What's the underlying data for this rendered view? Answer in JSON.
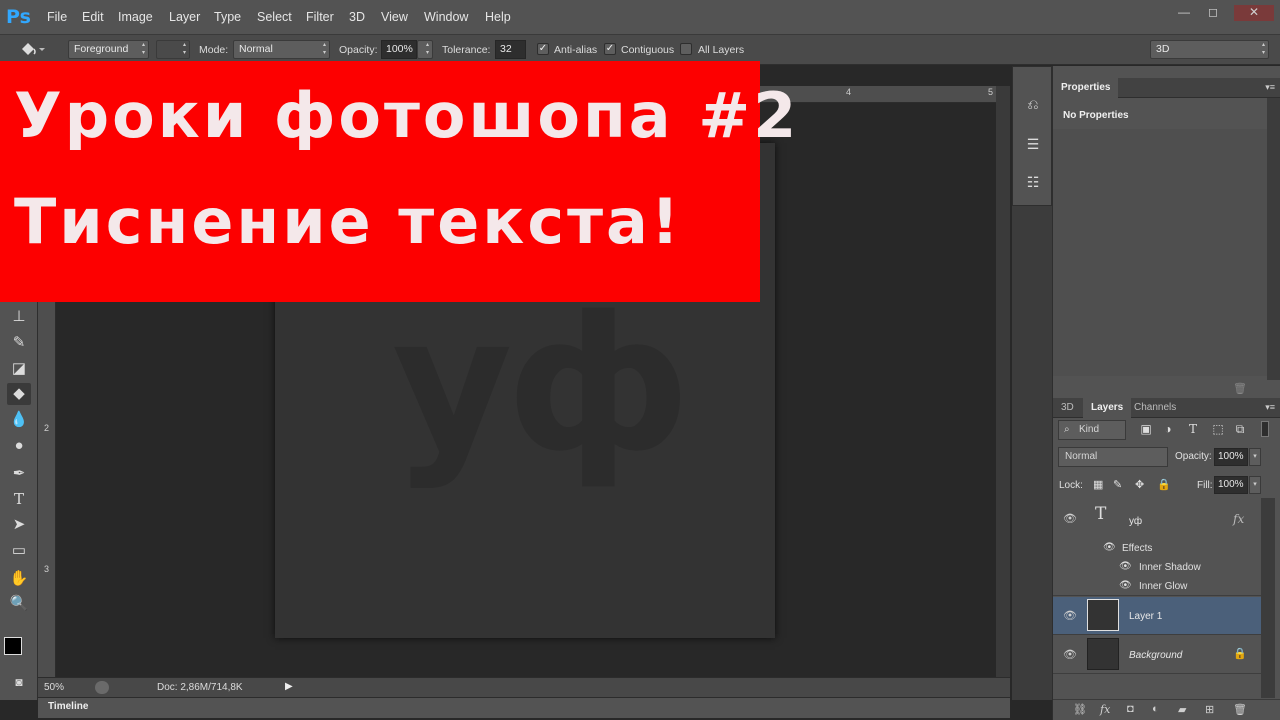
{
  "app": {
    "logo": "Ps"
  },
  "menu": [
    "File",
    "Edit",
    "Image",
    "Layer",
    "Type",
    "Select",
    "Filter",
    "3D",
    "View",
    "Window",
    "Help"
  ],
  "window_controls": {
    "minimize": "—",
    "restore": "◻",
    "close": "✕"
  },
  "options": {
    "source_value": "Foreground",
    "mode_label": "Mode:",
    "mode_value": "Normal",
    "opacity_label": "Opacity:",
    "opacity_value": "100%",
    "tolerance_label": "Tolerance:",
    "tolerance_value": "32",
    "anti_alias_label": "Anti-alias",
    "contiguous_label": "Contiguous",
    "all_layers_label": "All Layers",
    "workspace_value": "3D"
  },
  "rulers": {
    "top": [
      "4",
      "5"
    ],
    "left": [
      "2",
      "3"
    ]
  },
  "banner": {
    "line1": "Уроки фотошопа #2",
    "line2": "Тиснение текста!"
  },
  "canvas": {
    "text": "уф"
  },
  "status": {
    "zoom": "50%",
    "doc": "Doc: 2,86M/714,8K"
  },
  "timeline": {
    "label": "Timeline"
  },
  "properties": {
    "title": "Properties",
    "empty_message": "No Properties"
  },
  "layers_panel": {
    "tabs": [
      "3D",
      "Layers",
      "Channels"
    ],
    "filter_kind": "Kind",
    "blend_mode": "Normal",
    "opacity_label": "Opacity:",
    "opacity_value": "100%",
    "lock_label": "Lock:",
    "fill_label": "Fill:",
    "fill_value": "100%",
    "layers": [
      {
        "name": "уф",
        "type": "text",
        "fx": "fx"
      },
      {
        "name": "Layer 1",
        "selected": true
      },
      {
        "name": "Background",
        "locked": true
      }
    ],
    "effects_label": "Effects",
    "effects": [
      "Inner Shadow",
      "Inner Glow"
    ]
  },
  "colors": {
    "accent_red": "#fd0000",
    "selection": "#4b607a",
    "ps_blue": "#31a8ff"
  }
}
